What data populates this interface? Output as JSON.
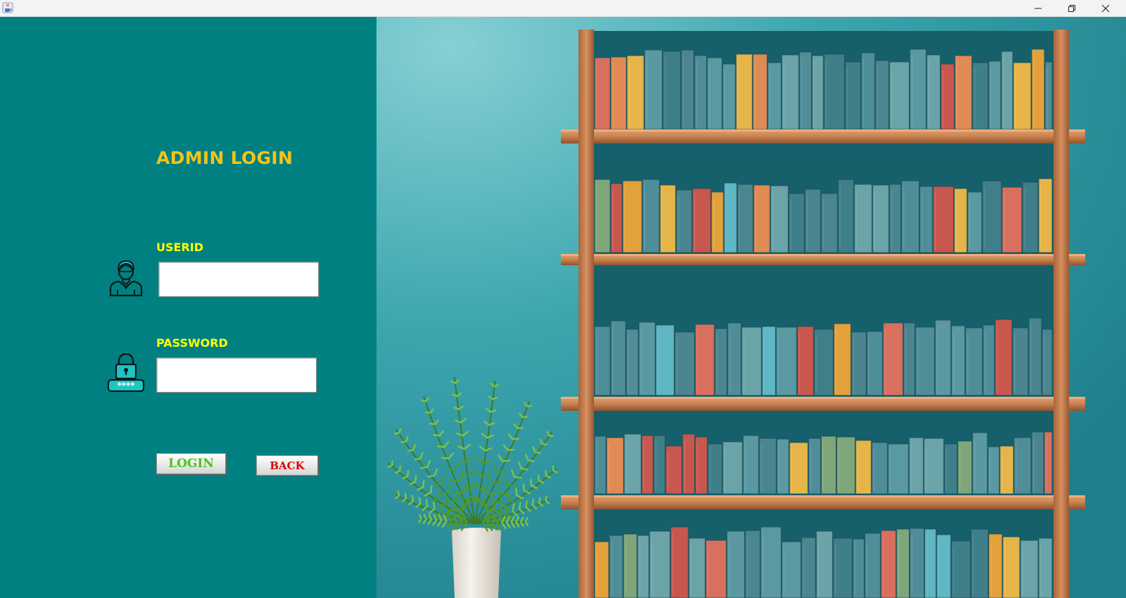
{
  "window": {
    "icon": "java-cup-icon",
    "controls": [
      "minimize-icon",
      "maximize-icon",
      "close-icon"
    ]
  },
  "login": {
    "title": "ADMIN LOGIN",
    "userid_label": "USERID",
    "userid_value": "",
    "password_label": "PASSWORD",
    "password_value": "",
    "login_button": "LOGIN",
    "back_button": "BACK"
  },
  "colors": {
    "panel": "#008080",
    "title": "#f2c31a",
    "labels": "#ffff00",
    "login_text": "#4cc51c",
    "back_text": "#e00000",
    "wall": "#2f9aa6",
    "wood": "#c07a47"
  },
  "illustration": {
    "subject": "bookshelf-with-plant",
    "icons": [
      "user-avatar-icon",
      "password-lock-icon"
    ]
  }
}
